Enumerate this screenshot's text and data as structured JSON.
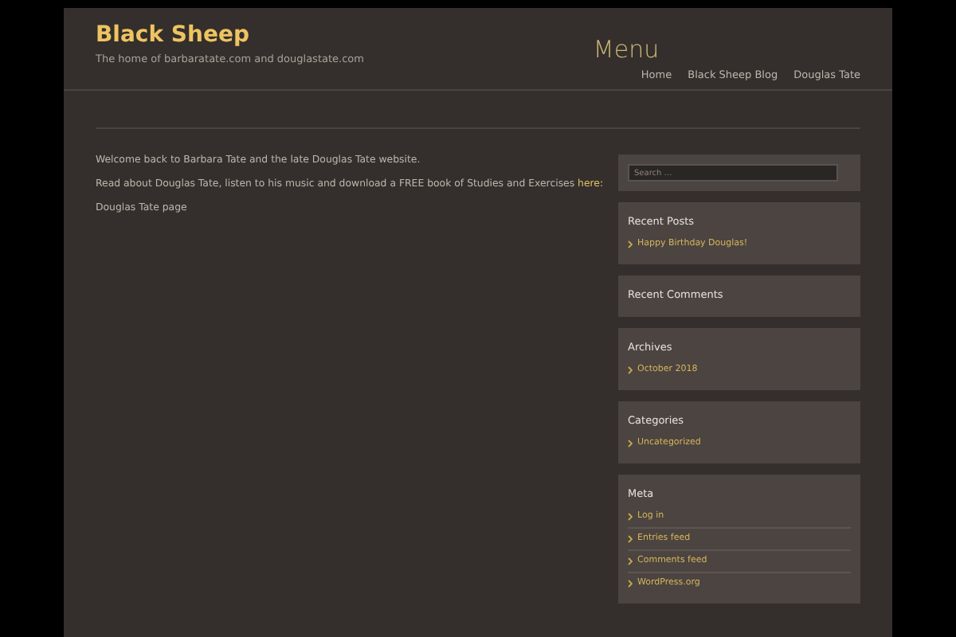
{
  "site": {
    "title": "Black Sheep",
    "tagline": "The home of barbaratate.com and douglastate.com"
  },
  "menu": {
    "title": "Menu",
    "items": [
      {
        "label": "Home"
      },
      {
        "label": "Black Sheep Blog"
      },
      {
        "label": "Douglas Tate"
      }
    ]
  },
  "content": {
    "paragraphs": [
      {
        "text": "Welcome back to Barbara Tate and the late Douglas Tate website."
      },
      {
        "text": "Read about Douglas Tate, listen to his music and download a FREE book of Studies and Exercises",
        "link": "here:"
      },
      {
        "text": "Douglas Tate page"
      }
    ]
  },
  "sidebar": {
    "search": {
      "placeholder": "Search …"
    },
    "widgets": [
      {
        "title": "Recent Posts",
        "items": [
          "Happy Birthday Douglas!"
        ]
      },
      {
        "title": "Recent Comments"
      },
      {
        "title": "Archives",
        "items": [
          "October 2018"
        ]
      },
      {
        "title": "Categories",
        "items": [
          "Uncategorized"
        ]
      },
      {
        "title": "Meta",
        "items": [
          "Log in",
          "Entries feed",
          "Comments feed",
          "WordPress.org"
        ]
      }
    ]
  }
}
